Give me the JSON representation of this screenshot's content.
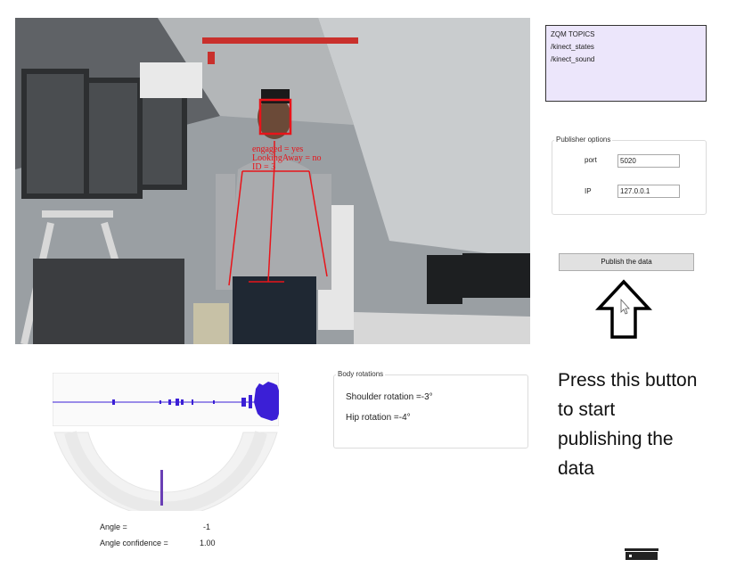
{
  "camera": {
    "overlay_lines": [
      "engaged = yes",
      "LookingAway = no",
      "ID = 3"
    ]
  },
  "zqm": {
    "title": "ZQM TOPICS",
    "topics": [
      "/kinect_states",
      "/kinect_sound"
    ]
  },
  "publisher": {
    "legend": "Publisher options",
    "port_label": "port",
    "port_value": "5020",
    "ip_label": "IP",
    "ip_value": "127.0.0.1",
    "button_label": "Publish the data"
  },
  "annotation": {
    "lines": [
      "Press this button",
      "to start",
      "publishing the",
      "data"
    ]
  },
  "rotations": {
    "legend": "Body rotations",
    "shoulder": "Shoulder rotation =-3°",
    "hip": "Hip rotation =-4°"
  },
  "sound": {
    "angle_label": "Angle =",
    "angle_value": "-1",
    "confidence_label": "Angle confidence =",
    "confidence_value": "1.00",
    "waveform_color": "#3b1fd6",
    "beam_color": "#6a3fb5"
  },
  "colors": {
    "overlay": "#e8141a",
    "zqm_bg": "#ece6fb"
  }
}
